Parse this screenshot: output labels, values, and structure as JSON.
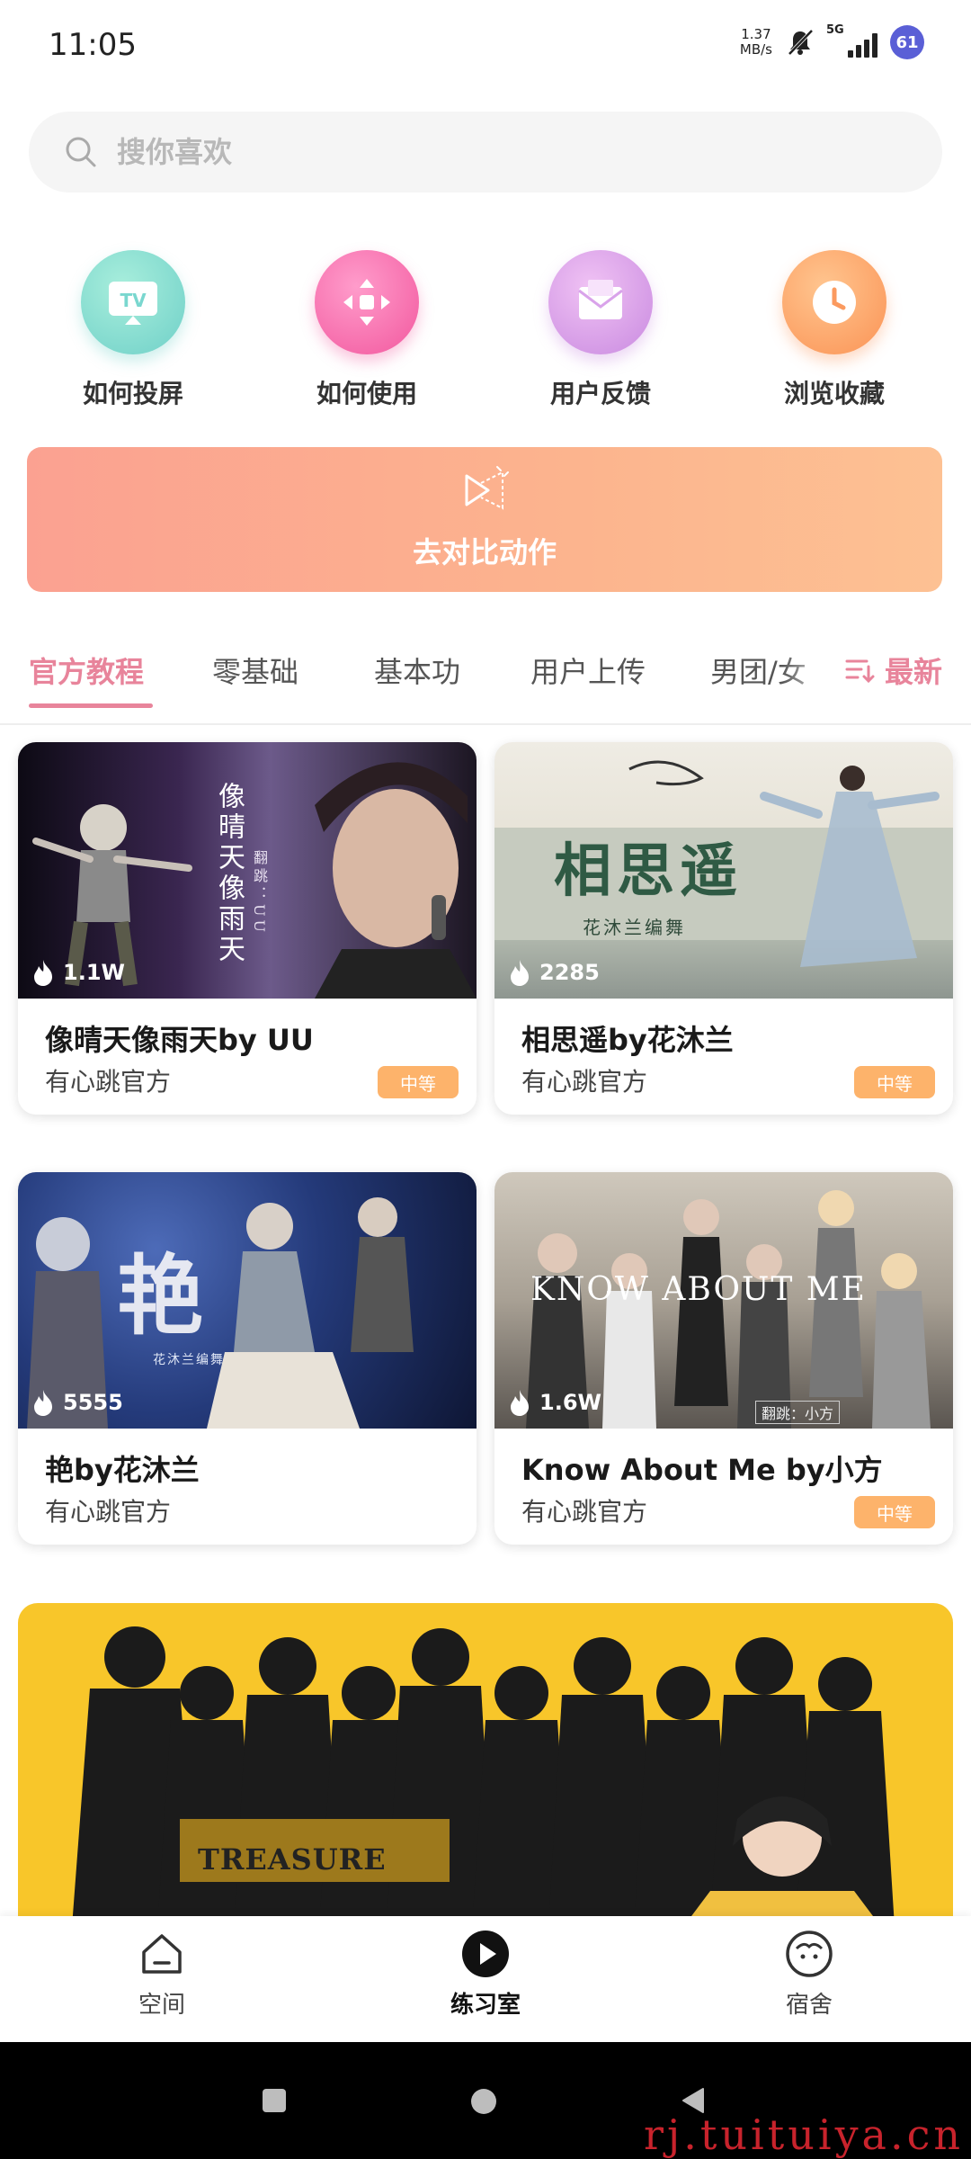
{
  "status_bar": {
    "time": "11:05",
    "net_speed_value": "1.37",
    "net_speed_unit": "MB/s",
    "network": "5G",
    "battery": "61",
    "icons": [
      "bell-off-icon",
      "signal-icon",
      "battery-icon"
    ]
  },
  "search": {
    "placeholder": "搜你喜欢",
    "icon": "search-icon"
  },
  "quick_actions": [
    {
      "label": "如何投屏",
      "icon": "tv-cast-icon",
      "color": "#7ed9c8"
    },
    {
      "label": "如何使用",
      "icon": "dpad-icon",
      "color": "#f46ea8"
    },
    {
      "label": "用户反馈",
      "icon": "mail-icon",
      "color": "#d99be6"
    },
    {
      "label": "浏览收藏",
      "icon": "clock-icon",
      "color": "#fca36a"
    }
  ],
  "compare_banner": {
    "label": "去对比动作",
    "icon": "compare-motion-icon"
  },
  "tabs": {
    "items": [
      "官方教程",
      "零基础",
      "基本功",
      "用户上传",
      "男团/女"
    ],
    "active_index": 0,
    "sort_label": "最新",
    "sort_icon": "sort-icon"
  },
  "cards": [
    {
      "views": "1.1W",
      "title": "像晴天像雨天by UU",
      "author": "有心跳官方",
      "level": "中等",
      "thumb_text": "像晴天像雨天",
      "thumb_sub": "翻跳：UU"
    },
    {
      "views": "2285",
      "title": "相思遥by花沐兰",
      "author": "有心跳官方",
      "level": "中等",
      "thumb_text": "相思遥",
      "thumb_sub": "花沐兰编舞"
    },
    {
      "views": "5555",
      "title": "艳by花沐兰",
      "author": "有心跳官方",
      "level": "",
      "thumb_text": "艳",
      "thumb_sub": "花沐兰编舞"
    },
    {
      "views": "1.6W",
      "title": "Know About Me by小方",
      "author": "有心跳官方",
      "level": "中等",
      "thumb_text": "KNOW ABOUT ME",
      "thumb_sub": "翻跳：小方"
    }
  ],
  "feature_banner": {
    "text": "TREASURE",
    "color": "#f8c62a"
  },
  "bottom_nav": [
    {
      "label": "空间",
      "icon": "home-icon"
    },
    {
      "label": "练习室",
      "icon": "play-circle-icon"
    },
    {
      "label": "宿舍",
      "icon": "face-icon"
    }
  ],
  "bottom_nav_active": 1,
  "watermark": "rj.tuituiya.cn",
  "colors": {
    "accent": "#e8849b",
    "level_badge": "#fdb36b",
    "banner_start": "#fba191",
    "banner_end": "#fdc193"
  }
}
